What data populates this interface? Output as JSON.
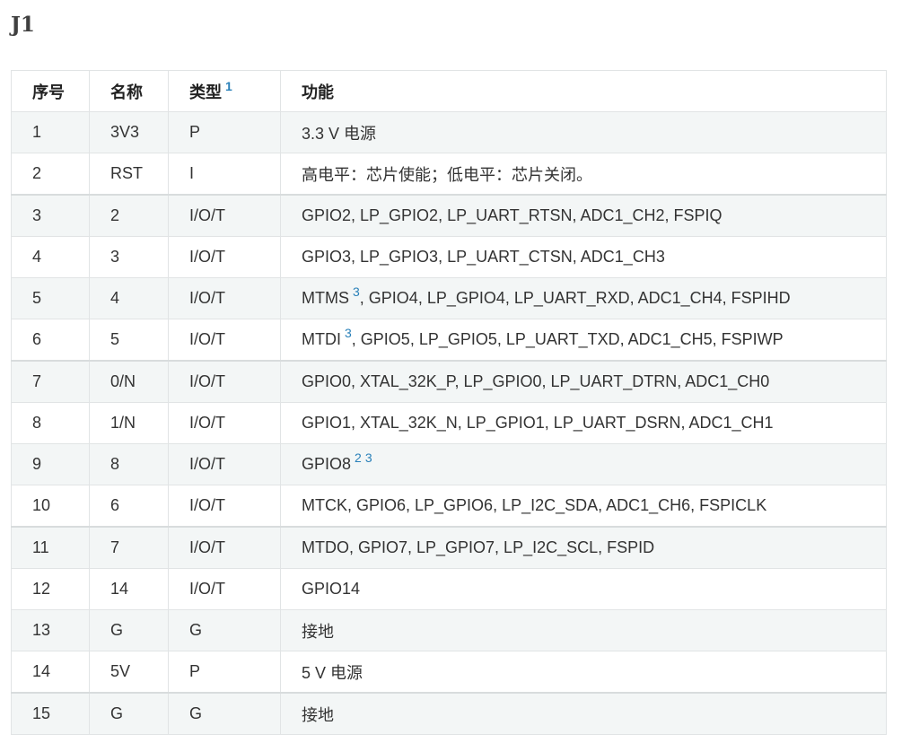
{
  "page": {
    "title": "J1"
  },
  "table": {
    "headers": {
      "num": "序号",
      "name": "名称",
      "type": "类型",
      "type_footnote": "1",
      "function": "功能"
    },
    "rows": [
      {
        "num": "1",
        "name": "3V3",
        "type": "P",
        "func": "3.3 V 电源"
      },
      {
        "num": "2",
        "name": "RST",
        "type": "I",
        "func": "高电平：芯片使能；低电平：芯片关闭。"
      },
      {
        "num": "3",
        "name": "2",
        "type": "I/O/T",
        "func": "GPIO2, LP_GPIO2, LP_UART_RTSN, ADC1_CH2, FSPIQ"
      },
      {
        "num": "4",
        "name": "3",
        "type": "I/O/T",
        "func": "GPIO3, LP_GPIO3, LP_UART_CTSN, ADC1_CH3"
      },
      {
        "num": "5",
        "name": "4",
        "type": "I/O/T",
        "func_prefix": "MTMS",
        "footnote": "3",
        "func_rest": ", GPIO4, LP_GPIO4, LP_UART_RXD, ADC1_CH4, FSPIHD"
      },
      {
        "num": "6",
        "name": "5",
        "type": "I/O/T",
        "func_prefix": "MTDI",
        "footnote": "3",
        "func_rest": ", GPIO5, LP_GPIO5, LP_UART_TXD, ADC1_CH5, FSPIWP"
      },
      {
        "num": "7",
        "name": "0/N",
        "type": "I/O/T",
        "func": "GPIO0, XTAL_32K_P, LP_GPIO0, LP_UART_DTRN, ADC1_CH0"
      },
      {
        "num": "8",
        "name": "1/N",
        "type": "I/O/T",
        "func": "GPIO1, XTAL_32K_N, LP_GPIO1, LP_UART_DSRN, ADC1_CH1"
      },
      {
        "num": "9",
        "name": "8",
        "type": "I/O/T",
        "func_prefix": "GPIO8",
        "footnote_a": "2",
        "footnote_b": "3"
      },
      {
        "num": "10",
        "name": "6",
        "type": "I/O/T",
        "func": "MTCK, GPIO6, LP_GPIO6, LP_I2C_SDA, ADC1_CH6, FSPICLK"
      },
      {
        "num": "11",
        "name": "7",
        "type": "I/O/T",
        "func": "MTDO, GPIO7, LP_GPIO7, LP_I2C_SCL, FSPID"
      },
      {
        "num": "12",
        "name": "14",
        "type": "I/O/T",
        "func": "GPIO14"
      },
      {
        "num": "13",
        "name": "G",
        "type": "G",
        "func": "接地"
      },
      {
        "num": "14",
        "name": "5V",
        "type": "P",
        "func": "5 V 电源"
      },
      {
        "num": "15",
        "name": "G",
        "type": "G",
        "func": "接地"
      }
    ]
  },
  "colors": {
    "link": "#2980b9",
    "row_stripe": "#f3f6f6",
    "border": "#e1e4e5"
  }
}
